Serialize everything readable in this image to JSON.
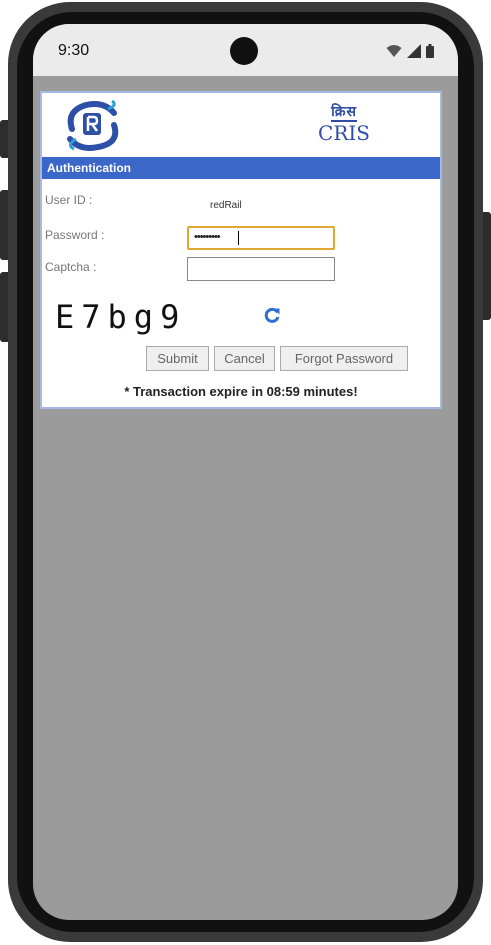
{
  "status_bar": {
    "time": "9:30"
  },
  "auth": {
    "header": "Authentication",
    "logos": {
      "cris_hindi": "क्रिस",
      "cris_text": "CRIS"
    },
    "user_id_label": "User ID :",
    "user_id_value": "redRail",
    "password_label": "Password :",
    "password_value": "•••••••••",
    "captcha_label": "Captcha :",
    "captcha_value": "",
    "captcha_code": "E7bg9",
    "buttons": {
      "submit": "Submit",
      "cancel": "Cancel",
      "forgot": "Forgot Password"
    },
    "expire_text": "* Transaction expire in 08:59 minutes!"
  },
  "icons": [
    "irctc-logo",
    "refresh-icon",
    "wifi-icon",
    "signal-icon",
    "battery-icon"
  ],
  "colors": {
    "header_bar": "#3b67c8",
    "focus_border": "#e0a832",
    "screen_bg": "#9b9b9b"
  }
}
